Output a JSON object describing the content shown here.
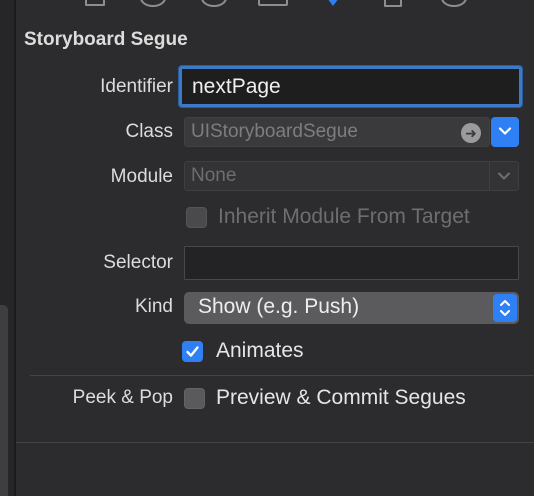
{
  "inspector_tabs": [
    {
      "icon": "file-icon"
    },
    {
      "icon": "history-icon"
    },
    {
      "icon": "help-icon"
    },
    {
      "icon": "identity-icon"
    },
    {
      "icon": "attributes-icon",
      "selected": true
    },
    {
      "icon": "size-icon"
    },
    {
      "icon": "connections-icon"
    }
  ],
  "section": {
    "title": "Storyboard Segue"
  },
  "identifier": {
    "label": "Identifier",
    "value": "nextPage"
  },
  "class": {
    "label": "Class",
    "value": "UIStoryboardSegue"
  },
  "module": {
    "label": "Module",
    "value": "None"
  },
  "inherit": {
    "label": "Inherit Module From Target",
    "checked": false
  },
  "selector": {
    "label": "Selector",
    "value": ""
  },
  "kind": {
    "label": "Kind",
    "value": "Show (e.g. Push)"
  },
  "animates": {
    "label": "Animates",
    "checked": true
  },
  "peek_pop": {
    "label": "Peek & Pop",
    "option_label": "Preview & Commit Segues",
    "checked": false
  },
  "colors": {
    "accent": "#2f7ff5",
    "background": "#2c2c2e",
    "focus_ring": "#3c79c7"
  }
}
